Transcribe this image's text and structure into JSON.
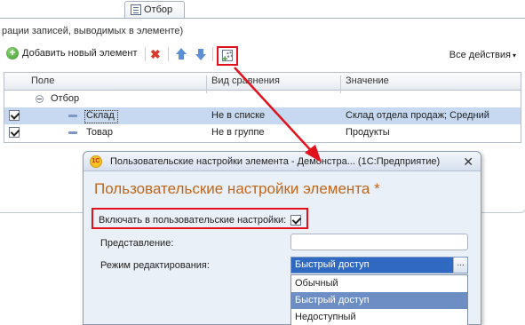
{
  "tab": {
    "label": "Отбор"
  },
  "panel": {
    "caption": "рации записей, выводимых в элементе)",
    "toolbar": {
      "add_label": "Добавить новый элемент",
      "all_actions_label": "Все действия",
      "all_actions_caret": "▾"
    },
    "grid": {
      "columns": [
        "Поле",
        "Вид сравнения",
        "Значение"
      ],
      "group_label": "Отбор",
      "rows": [
        {
          "field": "Склад",
          "comparison": "Не в списке",
          "value": "Склад отдела продаж; Средний",
          "checked": true
        },
        {
          "field": "Товар",
          "comparison": "Не в группе",
          "value": "Продукты",
          "checked": true
        }
      ]
    }
  },
  "dialog": {
    "logo_text": "1С",
    "title": "Пользовательские настройки элемента - Демонстра... (1С:Предприятие)",
    "close_glyph": "✕",
    "heading": "Пользовательские настройки элемента *",
    "include_label": "Включать в пользовательские настройки:",
    "include_checked": true,
    "presentation_label": "Представление:",
    "presentation_value": "",
    "edit_mode_label": "Режим редактирования:",
    "edit_mode_value": "Быстрый доступ",
    "select_button": "...",
    "options": [
      "Обычный",
      "Быстрый доступ",
      "Недоступный"
    ],
    "highlighted_option": "Быстрый доступ"
  },
  "colors": {
    "highlight_red": "#e1121b",
    "heading_orange": "#c0661a",
    "selected_row": "#c7d9f0",
    "select_blue": "#2f69c2"
  }
}
